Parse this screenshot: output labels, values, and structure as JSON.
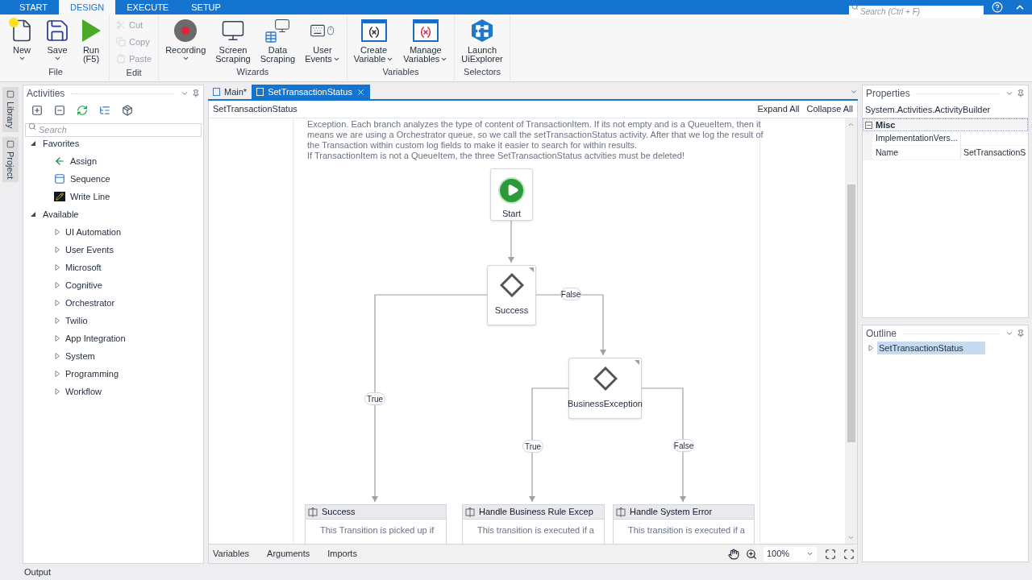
{
  "ribbon": {
    "tabs": [
      {
        "label": "START",
        "selected": false
      },
      {
        "label": "DESIGN",
        "selected": true
      },
      {
        "label": "EXECUTE",
        "selected": false
      },
      {
        "label": "SETUP",
        "selected": false
      }
    ],
    "search": {
      "placeholder": "Search (Ctrl + F)"
    },
    "groups": [
      {
        "label": "File",
        "kind": "large",
        "buttons": [
          {
            "lines": [
              "New"
            ],
            "dropdown": true,
            "disabled": false
          },
          {
            "lines": [
              "Save"
            ],
            "dropdown": true,
            "disabled": false
          },
          {
            "lines": [
              "Run",
              "(F5)"
            ],
            "dropdown": false,
            "disabled": false
          }
        ]
      },
      {
        "label": "Edit",
        "kind": "small",
        "buttons": [
          {
            "lines": [
              "Cut"
            ],
            "disabled": true
          },
          {
            "lines": [
              "Copy"
            ],
            "disabled": true
          },
          {
            "lines": [
              "Paste"
            ],
            "disabled": true
          }
        ]
      },
      {
        "label": "Wizards",
        "kind": "large",
        "buttons": [
          {
            "lines": [
              "Recording"
            ],
            "dropdown": true,
            "disabled": false
          },
          {
            "lines": [
              "Screen",
              "Scraping"
            ],
            "dropdown": false,
            "disabled": false
          },
          {
            "lines": [
              "Data",
              "Scraping"
            ],
            "dropdown": false,
            "disabled": false
          },
          {
            "lines": [
              "User",
              "Events"
            ],
            "dropdown": true,
            "disabled": false
          }
        ]
      },
      {
        "label": "Variables",
        "kind": "large",
        "buttons": [
          {
            "lines": [
              "Create",
              "Variable"
            ],
            "dropdown": true,
            "disabled": false
          },
          {
            "lines": [
              "Manage",
              "Variables"
            ],
            "dropdown": true,
            "disabled": false
          }
        ]
      },
      {
        "label": "Selectors",
        "kind": "large",
        "buttons": [
          {
            "lines": [
              "Launch",
              "UiExplorer"
            ],
            "dropdown": false,
            "disabled": false
          }
        ]
      }
    ]
  },
  "side_tabs": [
    "Library",
    "Project"
  ],
  "activities": {
    "title": "Activities",
    "search": {
      "placeholder": "Search"
    },
    "tree": [
      {
        "label": "Favorites",
        "expanded": true,
        "children": [
          {
            "label": "Assign"
          },
          {
            "label": "Sequence"
          },
          {
            "label": "Write Line"
          }
        ]
      },
      {
        "label": "Available",
        "expanded": true,
        "children": [
          {
            "label": "UI Automation",
            "expanded": false
          },
          {
            "label": "User Events",
            "expanded": false
          },
          {
            "label": "Microsoft",
            "expanded": false
          },
          {
            "label": "Cognitive",
            "expanded": false
          },
          {
            "label": "Orchestrator",
            "expanded": false
          },
          {
            "label": "Twilio",
            "expanded": false
          },
          {
            "label": "App Integration",
            "expanded": false
          },
          {
            "label": "System",
            "expanded": false
          },
          {
            "label": "Programming",
            "expanded": false
          },
          {
            "label": "Workflow",
            "expanded": false
          }
        ]
      }
    ]
  },
  "designer": {
    "tabs": [
      {
        "label": "Main*",
        "selected": false
      },
      {
        "label": "SetTransactionStatus",
        "selected": true
      }
    ],
    "breadcrumb": "SetTransactionStatus",
    "actions": [
      "Expand All",
      "Collapse All"
    ],
    "annotation": [
      "Exception. Each branch analyzes the type of content of TransactionItem. If its not empty and is a QueueItem, then it",
      "means we are using a Orchestrator queue, so we call the setTransactionStatus activity. After that we log the result of",
      "the Transaction within custom log fields to make it easier to search for within results.",
      "If TransactionItem is not a QueueItem, the three SetTransactionStatus actvities must be deleted!"
    ],
    "nodes": [
      {
        "kind": "start",
        "label": "Start"
      },
      {
        "kind": "decision",
        "label": "Success"
      },
      {
        "kind": "decision",
        "label": "BusinessException"
      },
      {
        "kind": "transition",
        "label": "Success",
        "description": "This Transition is picked up if"
      },
      {
        "kind": "transition",
        "label": "Handle Business Rule Excep",
        "description": "This transition is executed if a"
      },
      {
        "kind": "transition",
        "label": "Handle System Error",
        "description": "This transition is executed if a"
      }
    ],
    "edge_labels": [
      "False",
      "True",
      "True",
      "False"
    ],
    "bottom_tabs": [
      "Variables",
      "Arguments",
      "Imports"
    ],
    "zoom": "100%"
  },
  "properties": {
    "title": "Properties",
    "object": "System.Activities.ActivityBuilder",
    "category": {
      "label": "Misc",
      "expanded": true
    },
    "rows": [
      {
        "name": "ImplementationVers...",
        "value": ""
      },
      {
        "name": "Name",
        "value": "SetTransactionS"
      }
    ]
  },
  "outline": {
    "title": "Outline",
    "items": [
      {
        "label": "SetTransactionStatus",
        "selected": true,
        "expanded": false
      }
    ]
  },
  "status_bar": "Output"
}
